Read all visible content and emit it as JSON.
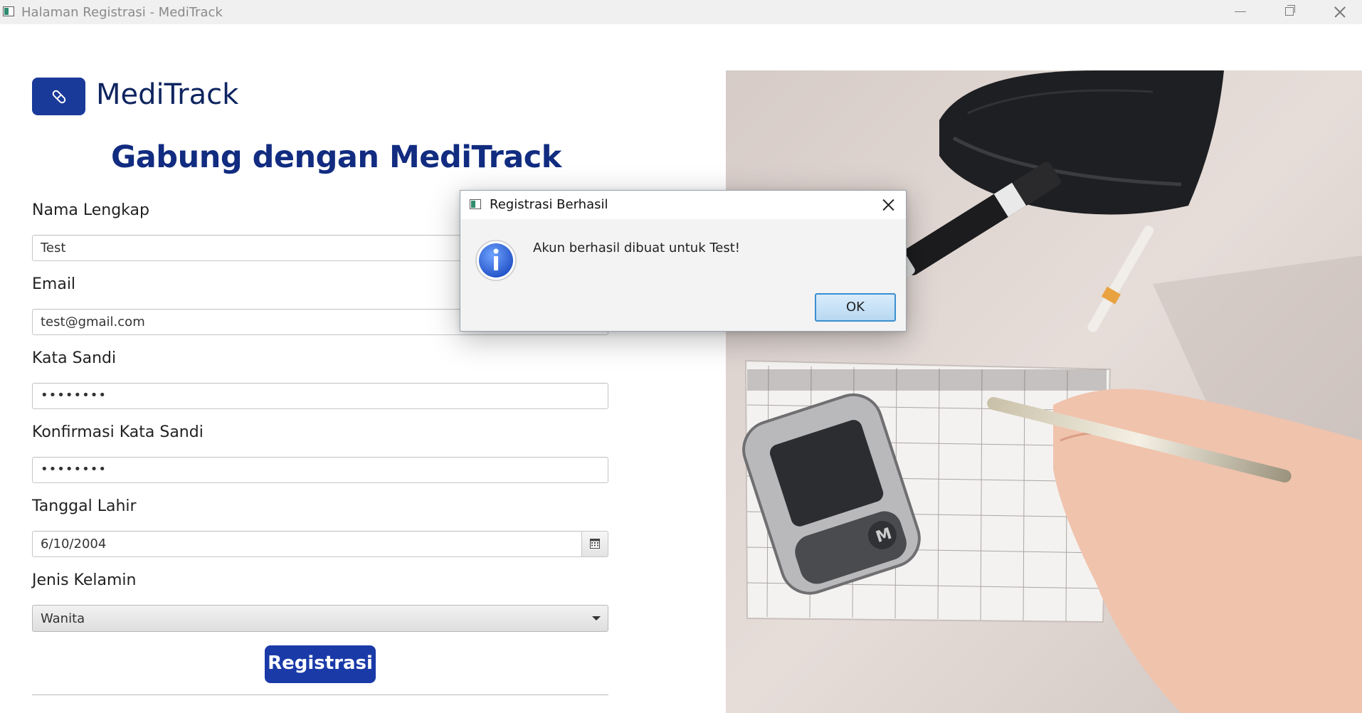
{
  "window": {
    "title": "Halaman Registrasi - MediTrack"
  },
  "brand": {
    "name": "MediTrack",
    "logo_icon": "pill-icon",
    "accent": "#1a3a9a"
  },
  "heading": "Gabung dengan MediTrack",
  "form": {
    "full_name": {
      "label": "Nama Lengkap",
      "value": "Test"
    },
    "email": {
      "label": "Email",
      "value": "test@gmail.com"
    },
    "password": {
      "label": "Kata Sandi",
      "value": "••••••••"
    },
    "confirm_password": {
      "label": "Konfirmasi Kata Sandi",
      "value": "••••••••"
    },
    "birth_date": {
      "label": "Tanggal Lahir",
      "value": "6/10/2004",
      "button_icon": "calendar-icon"
    },
    "gender": {
      "label": "Jenis Kelamin",
      "value": "Wanita"
    },
    "submit_label": "Registrasi"
  },
  "dialog": {
    "title": "Registrasi Berhasil",
    "message": "Akun berhasil dibuat untuk Test!",
    "icon": "info-icon",
    "ok_label": "OK"
  },
  "image": {
    "subject": "glucose-meter-photo"
  }
}
